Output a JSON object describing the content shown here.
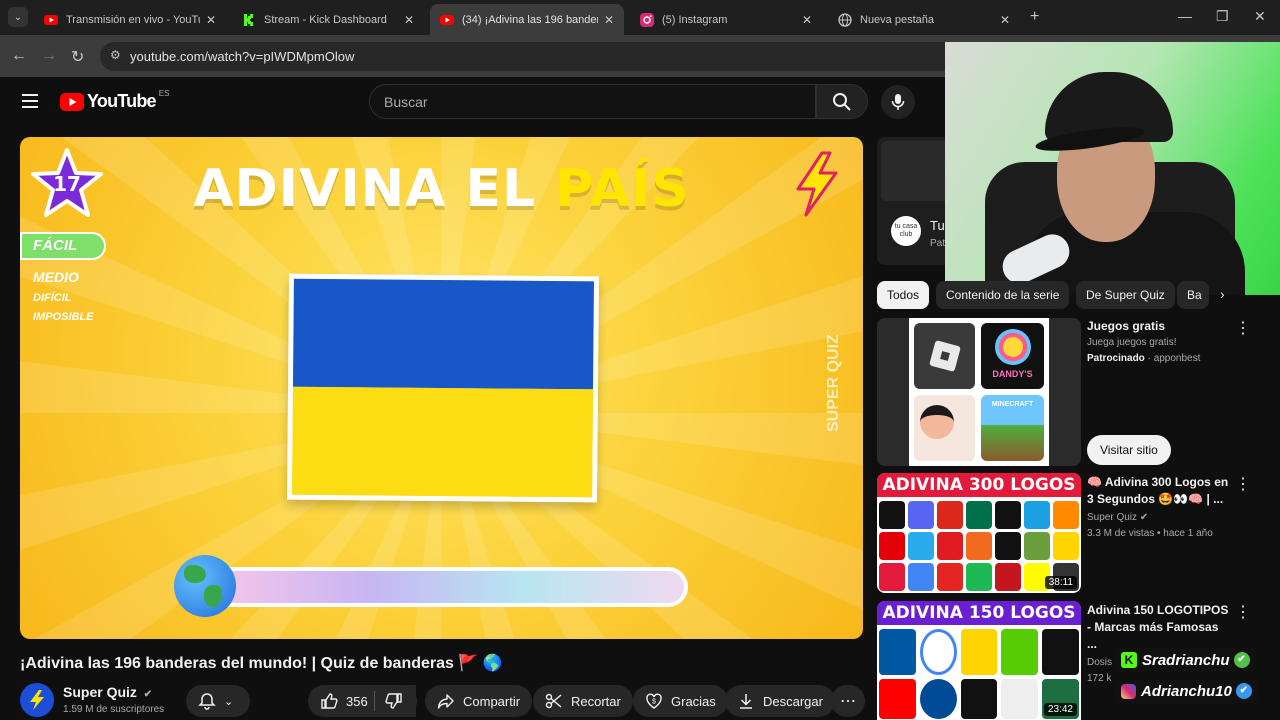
{
  "browser": {
    "tabs": [
      {
        "label": "Transmisión en vivo - YouTube",
        "icon": "youtube-icon",
        "active": false
      },
      {
        "label": "Stream - Kick Dashboard",
        "icon": "kick-icon",
        "active": false
      },
      {
        "label": "(34) ¡Adivina las 196 banderas d",
        "icon": "youtube-icon",
        "active": true
      },
      {
        "label": "(5) Instagram",
        "icon": "instagram-icon",
        "active": false
      },
      {
        "label": "Nueva pestaña",
        "icon": "globe-icon",
        "active": false
      }
    ],
    "url": "youtube.com/watch?v=pIWDMpmOlow"
  },
  "youtube": {
    "logo": "YouTube",
    "region": "ES",
    "search_placeholder": "Buscar"
  },
  "video": {
    "overlay_title_a": "ADIVINA EL",
    "overlay_title_b": "PAÍS",
    "level": "17",
    "difficulties": [
      "FÁCIL",
      "MEDIO",
      "DIFÍCIL",
      "IMPOSIBLE"
    ],
    "watermark": "SUPER QUIZ",
    "title": "¡Adivina las 196 banderas del mundo! | Quiz de banderas 🚩 🌎",
    "channel": "Super Quiz",
    "subscribers": "1.59 M de suscriptores",
    "likes": "356",
    "actions": [
      "Compartir",
      "Recortar",
      "Gracias",
      "Descargar"
    ]
  },
  "sidebar": {
    "ad_channel_short": "Tu",
    "ad_channel_sub": "Pat",
    "ad_logo": "tu casa club",
    "chips": [
      "Todos",
      "Contenido de la serie",
      "De Super Quiz",
      "Ba"
    ],
    "sponsored": {
      "title": "Juegos gratis",
      "subtitle": "Juega juegos gratis!",
      "label": "Patrocinado",
      "advertiser": "apponbest",
      "button": "Visitar sitio",
      "thumb_text": "DANDY'S",
      "thumb_text2": "MINECRAFT"
    },
    "videos": [
      {
        "title": "🧠 Adivina 300 Logos en 3 Segundos 🤩👀🧠 | ...",
        "channel": "Super Quiz",
        "meta": "3.3 M de vistas • hace 1 año",
        "duration": "38:11",
        "thumb_banner": "ADIVINA 300 LOGOS"
      },
      {
        "title": "Adivina 150 LOGOTIPOS - Marcas más Famosas ...",
        "channel": "Dosis de Q...",
        "meta": "172 k",
        "duration": "23:42",
        "thumb_banner": "ADIVINA 150 LOGOS"
      }
    ]
  },
  "stream_overlay": {
    "kick_handle": "Sradrianchu",
    "instagram_handle": "Adrianchu10"
  },
  "colors": {
    "yt_red": "#ff0000",
    "flag_blue": "#1757c7",
    "flag_yellow": "#fcdc12",
    "kick_green": "#53fc18"
  }
}
